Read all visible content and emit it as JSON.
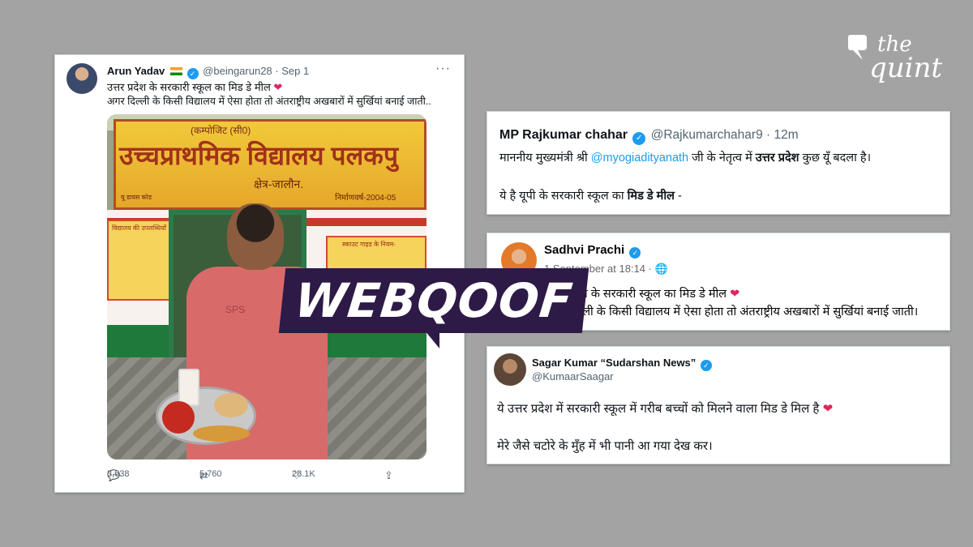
{
  "brand": {
    "logo_the": "the",
    "logo_quint": "quint"
  },
  "overlay": {
    "label": "WEBQOOF"
  },
  "tweet_main": {
    "name": "Arun Yadav",
    "handle": "@beingarun28",
    "separator": "·",
    "date": "Sep 1",
    "more": "···",
    "text_line1": "उत्तर प्रदेश के सरकारी स्कूल का मिड डे मील",
    "text_line2": "अगर दिल्ली के किसी विद्यालय में ऐसा होता तो अंतराष्ट्रीय अखबारों में सुर्खियां बनाई जाती..",
    "heart": "❤",
    "photo": {
      "sign_top": "(कम्पोजिट (सी0)",
      "sign_main": "उच्चप्राथमिक विद्यालय पलकपु",
      "sign_area": "क्षेत्र-जालौन.",
      "sign_year": "निर्माणवर्ष-2004-05",
      "sign_small": "यू डायस कोड",
      "board_left": "विद्यालय की उपलब्धियाँ",
      "board_right": "स्काउट गाइड के नियम-",
      "shirt_text": "SPS"
    },
    "stats": {
      "replies": "3,638",
      "retweets": "5,760",
      "likes": "28.1K"
    },
    "icons": {
      "reply": "reply-icon",
      "retweet": "retweet-icon",
      "like": "heart-icon",
      "share": "share-icon"
    }
  },
  "tweet_raj": {
    "name": "MP Rajkumar chahar",
    "handle": "@Rajkumarchahar9",
    "separator": "·",
    "time": "12m",
    "line1_a": "माननीय मुख्यमंत्री श्री",
    "line1_mention": "@myogiadityanath",
    "line1_b": "जी के नेतृत्व में",
    "line1_bold": "उत्तर प्रदेश",
    "line1_c": "कुछ यूँ बदला है।",
    "line2_a": "ये है यूपी के सरकारी स्कूल का",
    "line2_bold": "मिड डे मील",
    "line2_b": "-"
  },
  "post_sadhvi": {
    "name": "Sadhvi Prachi",
    "date": "1 September at 18:14 ·",
    "globe": "🌐",
    "line1": "उत्तर प्रदेश के सरकारी स्कूल का मिड डे मील",
    "heart": "❤",
    "line2": "अगर दिल्ली के किसी विद्यालय में ऐसा होता तो अंतराष्ट्रीय अखबारों में सुर्खियां बनाई जाती।"
  },
  "tweet_sagar": {
    "name": "Sagar Kumar “Sudarshan News”",
    "handle": "@KumaarSaagar",
    "line1": "ये उत्तर प्रदेश में सरकारी स्कूल में गरीब बच्चों को मिलने वाला मिड डे मिल है",
    "heart": "❤",
    "line2": "मेरे जैसे चटोरे के मुँह में भी पानी आ गया देख कर।"
  },
  "colors": {
    "background": "#a3a3a3",
    "twitter_blue": "#1d9bf0",
    "heart_red": "#e0245e",
    "webqoof_purple": "#2d1a47"
  }
}
